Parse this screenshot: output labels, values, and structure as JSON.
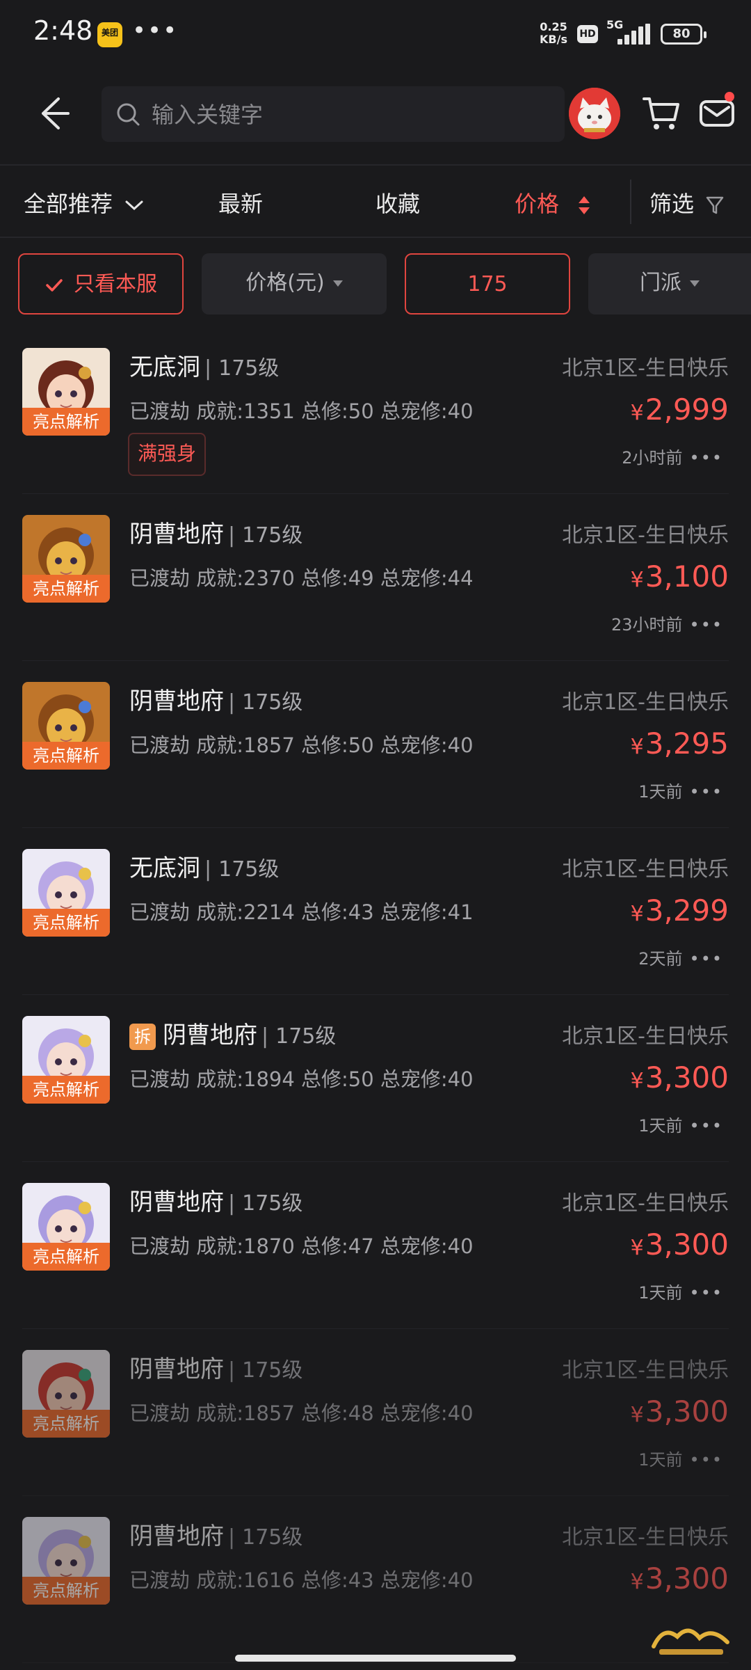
{
  "status_bar": {
    "time": "2:48",
    "app_icon_text": "美团",
    "dots": "•••",
    "net_speed_value": "0.25",
    "net_speed_unit": "KB/s",
    "hd": "HD",
    "network": "5G",
    "battery": "80"
  },
  "search": {
    "placeholder": "输入关键字"
  },
  "sort_tabs": {
    "all": "全部推荐",
    "latest": "最新",
    "favorite": "收藏",
    "price": "价格",
    "filter": "筛选"
  },
  "filters": {
    "same_server": "只看本服",
    "price": "价格(元)",
    "level": "175",
    "school": "门派"
  },
  "colors": {
    "accent": "#ff5a55",
    "tag": "#ec6a2c",
    "background": "#1a1a1c"
  },
  "listings": [
    {
      "school": "无底洞",
      "level": "175级",
      "server": "北京1区-生日快乐",
      "stats": "已渡劫 成就:1351 总修:50 总宠修:40",
      "currency": "¥",
      "price": "2,999",
      "time": "2小时前",
      "badge": "满强身",
      "tag": "亮点解析",
      "chai": ""
    },
    {
      "school": "阴曹地府",
      "level": "175级",
      "server": "北京1区-生日快乐",
      "stats": "已渡劫 成就:2370 总修:49 总宠修:44",
      "currency": "¥",
      "price": "3,100",
      "time": "23小时前",
      "badge": "",
      "tag": "亮点解析",
      "chai": ""
    },
    {
      "school": "阴曹地府",
      "level": "175级",
      "server": "北京1区-生日快乐",
      "stats": "已渡劫 成就:1857 总修:50 总宠修:40",
      "currency": "¥",
      "price": "3,295",
      "time": "1天前",
      "badge": "",
      "tag": "亮点解析",
      "chai": ""
    },
    {
      "school": "无底洞",
      "level": "175级",
      "server": "北京1区-生日快乐",
      "stats": "已渡劫 成就:2214 总修:43 总宠修:41",
      "currency": "¥",
      "price": "3,299",
      "time": "2天前",
      "badge": "",
      "tag": "亮点解析",
      "chai": ""
    },
    {
      "school": "阴曹地府",
      "level": "175级",
      "server": "北京1区-生日快乐",
      "stats": "已渡劫 成就:1894 总修:50 总宠修:40",
      "currency": "¥",
      "price": "3,300",
      "time": "1天前",
      "badge": "",
      "tag": "亮点解析",
      "chai": "拆"
    },
    {
      "school": "阴曹地府",
      "level": "175级",
      "server": "北京1区-生日快乐",
      "stats": "已渡劫 成就:1870 总修:47 总宠修:40",
      "currency": "¥",
      "price": "3,300",
      "time": "1天前",
      "badge": "",
      "tag": "亮点解析",
      "chai": ""
    },
    {
      "school": "阴曹地府",
      "level": "175级",
      "server": "北京1区-生日快乐",
      "stats": "已渡劫 成就:1857 总修:48 总宠修:40",
      "currency": "¥",
      "price": "3,300",
      "time": "1天前",
      "badge": "",
      "tag": "亮点解析",
      "chai": ""
    },
    {
      "school": "阴曹地府",
      "level": "175级",
      "server": "北京1区-生日快乐",
      "stats": "已渡劫 成就:1616 总修:43 总宠修:40",
      "currency": "¥",
      "price": "3,300",
      "time": "",
      "badge": "",
      "tag": "亮点解析",
      "chai": ""
    }
  ],
  "separator": "|",
  "more": "•••"
}
